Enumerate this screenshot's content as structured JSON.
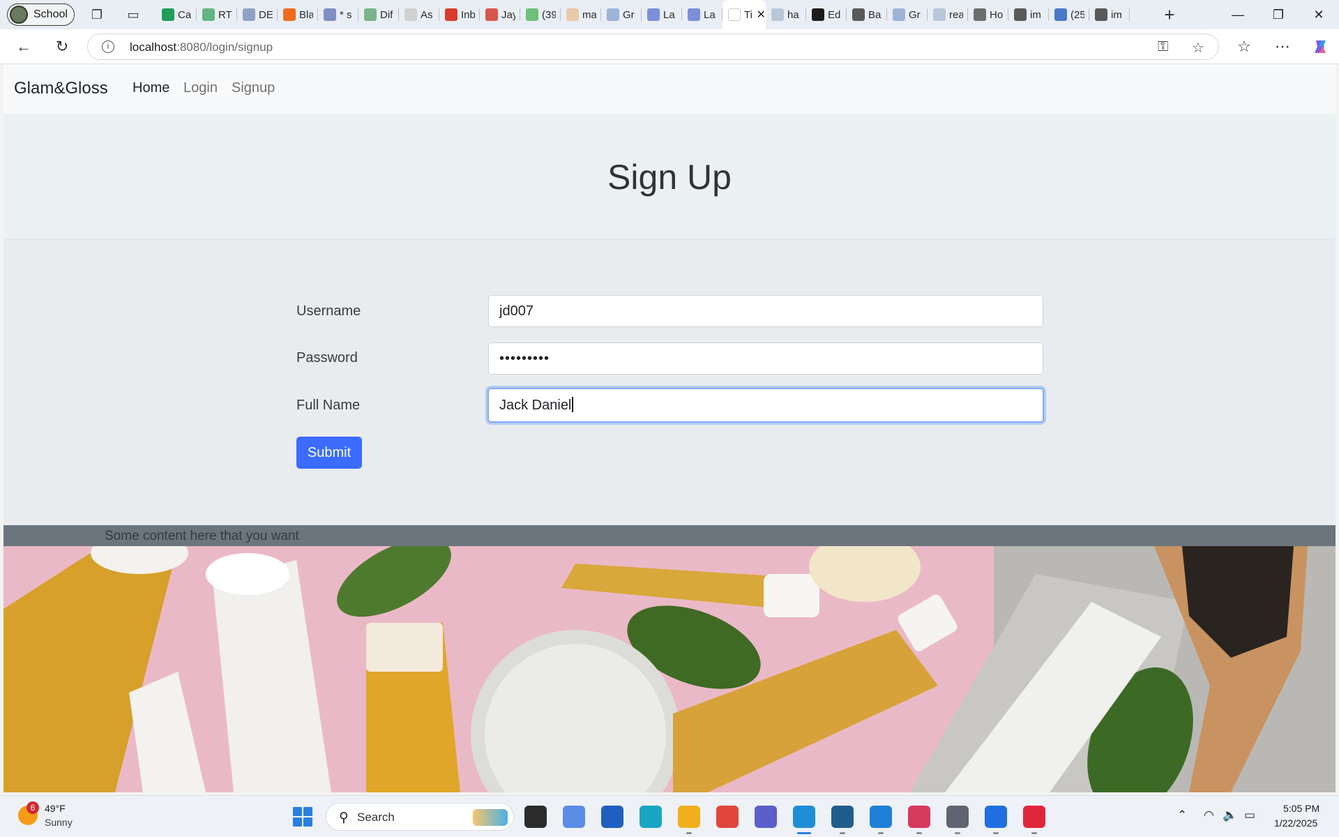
{
  "browser": {
    "profile_name": "School",
    "tabs": [
      {
        "label": "Ca",
        "icon": "sheets-icon",
        "color": "#1e9e5a"
      },
      {
        "label": "RT",
        "icon": "sheets-icon",
        "color": "#63b582"
      },
      {
        "label": "DE",
        "icon": "database-icon",
        "color": "#8ea3c4"
      },
      {
        "label": "Bla",
        "icon": "blackboard-icon",
        "color": "#f26b1d"
      },
      {
        "label": "* s",
        "icon": "doc-icon",
        "color": "#7f8ec4"
      },
      {
        "label": "Dif",
        "icon": "diff-icon",
        "color": "#7cb48a"
      },
      {
        "label": "As",
        "icon": "gmail-icon",
        "color": "#d0d0d0"
      },
      {
        "label": "Inb",
        "icon": "gmail-icon",
        "color": "#d93b2b"
      },
      {
        "label": "Jay",
        "icon": "pdf-icon",
        "color": "#d8564a"
      },
      {
        "label": "(39",
        "icon": "chat-icon",
        "color": "#6fbf7a"
      },
      {
        "label": "ma",
        "icon": "feather-icon",
        "color": "#e8c9a8"
      },
      {
        "label": "Gr",
        "icon": "diamond-icon",
        "color": "#9fb3d8"
      },
      {
        "label": "La",
        "icon": "zoom-icon",
        "color": "#7d8fd9"
      },
      {
        "label": "La",
        "icon": "zoom-icon",
        "color": "#7d8fd9"
      },
      {
        "label": "Tit",
        "icon": "page-icon",
        "color": "#ffffff",
        "active": true
      },
      {
        "label": "ha",
        "icon": "search-icon",
        "color": "#b9c6d8"
      },
      {
        "label": "Ed",
        "icon": "github-icon",
        "color": "#1c1c1c"
      },
      {
        "label": "Ba",
        "icon": "github-icon",
        "color": "#5a5a5a"
      },
      {
        "label": "Gr",
        "icon": "diamond-icon",
        "color": "#9fb3d8"
      },
      {
        "label": "rea",
        "icon": "search-icon",
        "color": "#b9c6d8"
      },
      {
        "label": "Ho",
        "icon": "lambda-icon",
        "color": "#6d6d6d"
      },
      {
        "label": "im",
        "icon": "github-icon",
        "color": "#5a5a5a"
      },
      {
        "label": "(25",
        "icon": "linkedin-icon",
        "color": "#4a78c8"
      },
      {
        "label": "im",
        "icon": "github-icon",
        "color": "#5a5a5a"
      }
    ],
    "url_host": "localhost",
    "url_path": ":8080/login/signup"
  },
  "site": {
    "brand": "Glam&Gloss",
    "nav": [
      {
        "label": "Home",
        "active": true
      },
      {
        "label": "Login",
        "active": false
      },
      {
        "label": "Signup",
        "active": false
      }
    ],
    "heading": "Sign Up",
    "form": {
      "username_label": "Username",
      "username_value": "jd007",
      "password_label": "Password",
      "password_mask": "•••••••••",
      "fullname_label": "Full Name",
      "fullname_value": "Jack Daniel",
      "submit_label": "Submit"
    },
    "footer_text": "Some content here that you want"
  },
  "taskbar": {
    "weather_badge": "6",
    "weather_temp": "49°F",
    "weather_condition": "Sunny",
    "search_label": "Search",
    "clock_time": "5:05 PM",
    "clock_date": "1/22/2025",
    "apps": [
      {
        "name": "task-view-icon",
        "color": "#2b2b2b",
        "running": false
      },
      {
        "name": "copilot-icon",
        "color": "#5b8de6",
        "running": false
      },
      {
        "name": "store-icon",
        "color": "#1f5fbf",
        "running": false
      },
      {
        "name": "cortana-icon",
        "color": "#1aa5c4",
        "running": false
      },
      {
        "name": "file-explorer-icon",
        "color": "#f2b01e",
        "running": true
      },
      {
        "name": "chrome-icon",
        "color": "#e0463a",
        "running": false
      },
      {
        "name": "teams-icon",
        "color": "#5b5fc7",
        "running": false
      },
      {
        "name": "edge-icon",
        "color": "#1e8fd6",
        "running": true,
        "current": true
      },
      {
        "name": "mysql-workbench-icon",
        "color": "#1f5d8c",
        "running": true
      },
      {
        "name": "notepad-icon",
        "color": "#1f7fd6",
        "running": true
      },
      {
        "name": "slack-icon",
        "color": "#d7385e",
        "running": true
      },
      {
        "name": "settings-icon",
        "color": "#5f6470",
        "running": true
      },
      {
        "name": "maps-icon",
        "color": "#1f6fe0",
        "running": true
      },
      {
        "name": "intellij-icon",
        "color": "#e0263b",
        "running": true
      }
    ]
  }
}
